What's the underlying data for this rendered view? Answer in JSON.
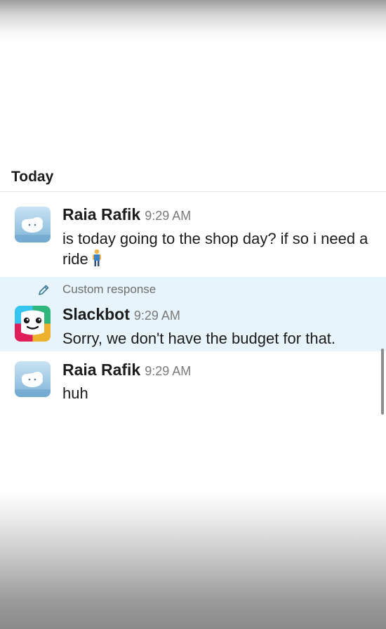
{
  "day_divider": {
    "label": "Today"
  },
  "messages": [
    {
      "sender": "Raia Rafik",
      "time": "9:29 AM",
      "text": "is today going to the shop day? if so i need a ride",
      "emoji": "person-standing-emoji",
      "avatar": "cloud-avatar"
    },
    {
      "custom_label": "Custom response",
      "sender": "Slackbot",
      "time": "9:29 AM",
      "text": "Sorry, we don't have the budget for that.",
      "avatar": "slackbot-avatar",
      "highlight_color": "#e8f4fb"
    },
    {
      "sender": "Raia Rafik",
      "time": "9:29 AM",
      "text": "huh",
      "avatar": "cloud-avatar"
    }
  ]
}
